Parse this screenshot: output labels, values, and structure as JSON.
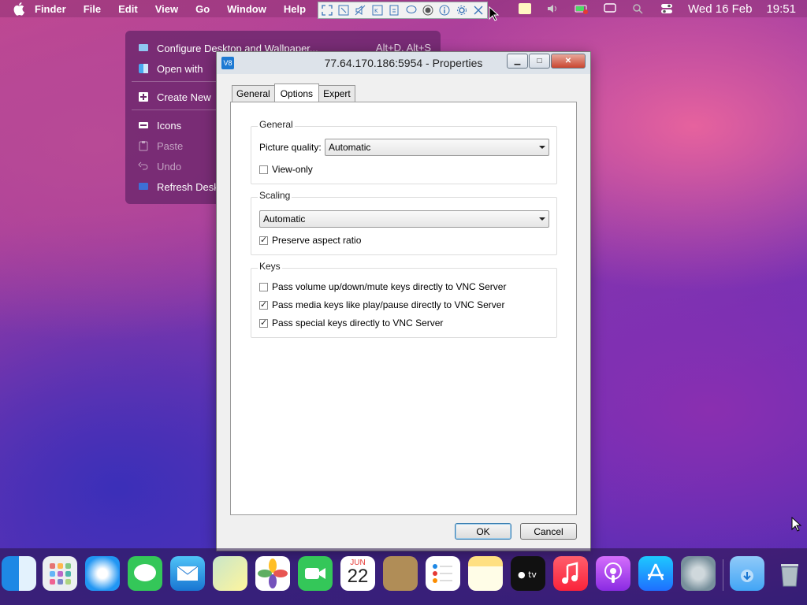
{
  "menubar": {
    "items": [
      "Finder",
      "File",
      "Edit",
      "View",
      "Go",
      "Window",
      "Help"
    ],
    "date": "Wed 16 Feb",
    "time": "19:51"
  },
  "context_menu": {
    "items": [
      {
        "label": "Configure Desktop and Wallpaper...",
        "shortcut": "Alt+D, Alt+S",
        "icon": "monitor-icon"
      },
      {
        "label": "Open with",
        "icon": "finder-icon"
      },
      {
        "label": "Create New",
        "icon": "plus-icon"
      },
      {
        "label": "Icons",
        "icon": "icons-icon"
      },
      {
        "label": "Paste",
        "icon": "clipboard-icon"
      },
      {
        "label": "Undo",
        "icon": "undo-icon"
      },
      {
        "label": "Refresh Desktop",
        "icon": "refresh-icon"
      }
    ]
  },
  "window": {
    "title": "77.64.170.186:5954 - Properties",
    "app_icon_text": "V8",
    "tabs": [
      "General",
      "Options",
      "Expert"
    ],
    "active_tab": "Options",
    "groups": {
      "general": {
        "title": "General",
        "picture_quality_label": "Picture quality:",
        "picture_quality_value": "Automatic",
        "view_only_label": "View-only",
        "view_only_checked": false
      },
      "scaling": {
        "title": "Scaling",
        "scaling_value": "Automatic",
        "preserve_aspect_label": "Preserve aspect ratio",
        "preserve_aspect_checked": true
      },
      "keys": {
        "title": "Keys",
        "volume_label": "Pass volume up/down/mute keys directly to VNC Server",
        "volume_checked": false,
        "media_label": "Pass media keys like play/pause directly to VNC Server",
        "media_checked": true,
        "special_label": "Pass special keys directly to VNC Server",
        "special_checked": true
      }
    },
    "ok_label": "OK",
    "cancel_label": "Cancel"
  },
  "dock": {
    "apps": [
      "Finder",
      "Launchpad",
      "Safari",
      "Messages",
      "Mail",
      "Maps",
      "Photos",
      "FaceTime",
      "Calendar",
      "Contacts",
      "Reminders",
      "Notes",
      "Apple TV",
      "Music",
      "Podcasts",
      "App Store",
      "System Preferences",
      "Downloads",
      "Trash"
    ],
    "calendar_month": "JUN",
    "calendar_day": "22"
  },
  "colors": {
    "accent": "#1e7ad3",
    "titlebar": "#dde3ea",
    "close_button": "#c9452f"
  }
}
